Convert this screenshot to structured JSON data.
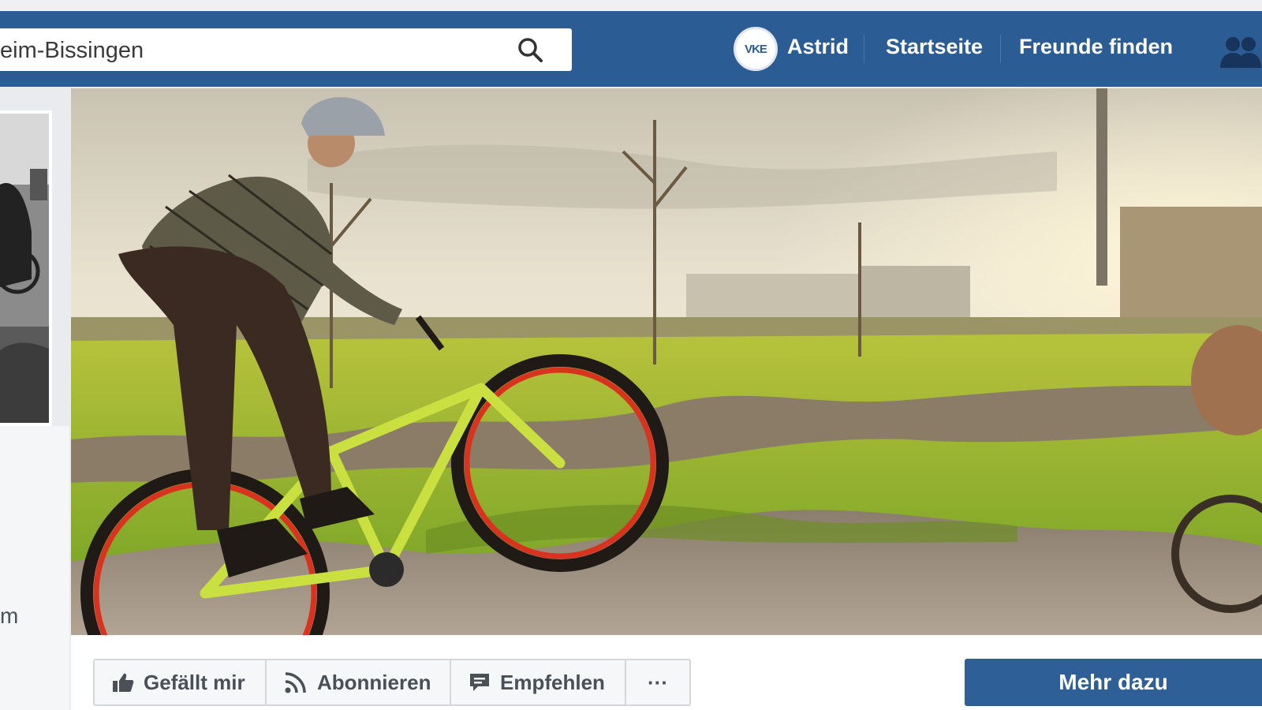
{
  "search": {
    "value": "eim-Bissingen"
  },
  "header": {
    "avatar_initials": "VKE",
    "user_name": "Astrid",
    "home_label": "Startseite",
    "find_friends_label": "Freunde finden"
  },
  "left": {
    "partial_text": "m"
  },
  "actions": {
    "like_label": "Gefällt mir",
    "follow_label": "Abonnieren",
    "recommend_label": "Empfehlen",
    "more_options_label": "···",
    "learn_more_label": "Mehr dazu"
  },
  "icons": {
    "search": "search-icon",
    "friends": "friends-icon",
    "like": "thumbs-up-icon",
    "follow": "rss-icon",
    "recommend": "speech-bubble-icon"
  },
  "colors": {
    "topbar": "#2b5d94",
    "primary_button": "#2f5f97",
    "page_background": "#e9ebee"
  }
}
